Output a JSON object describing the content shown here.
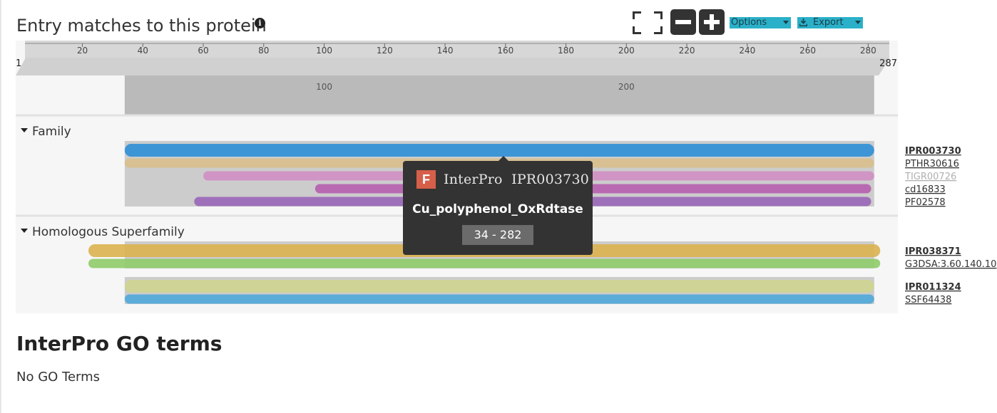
{
  "title": "Entry matches to this protein",
  "toolbar": {
    "options_label": "Options",
    "export_label": "Export"
  },
  "protein": {
    "length": 287,
    "start_label": "1",
    "end_label": "287",
    "ticks": [
      20,
      40,
      60,
      80,
      100,
      120,
      140,
      160,
      180,
      200,
      220,
      240,
      260,
      280
    ],
    "zoom_window": [
      34,
      282
    ],
    "zoom_ticks": [
      100,
      200
    ]
  },
  "sections": [
    {
      "label": "Family",
      "groups": [
        {
          "labels": [
            {
              "text": "IPR003730",
              "bold": true,
              "muted": false
            },
            {
              "text": "PTHR30616",
              "bold": false,
              "muted": false
            },
            {
              "text": "TIGR00726",
              "bold": false,
              "muted": true
            },
            {
              "text": "cd16833",
              "bold": false,
              "muted": false
            },
            {
              "text": "PF02578",
              "bold": false,
              "muted": false
            }
          ],
          "backdrop": [
            34,
            282
          ],
          "tracks": [
            {
              "start": 34,
              "end": 282,
              "color": "#2f8fd6"
            },
            {
              "start": 34,
              "end": 282,
              "color": "#d9bf8c"
            },
            {
              "start": 60,
              "end": 282,
              "color": "#d08fc3"
            },
            {
              "start": 97,
              "end": 281,
              "color": "#b65eaf"
            },
            {
              "start": 57,
              "end": 281,
              "color": "#9a66b8"
            }
          ]
        }
      ]
    },
    {
      "label": "Homologous Superfamily",
      "groups": [
        {
          "labels": [
            {
              "text": "IPR038371",
              "bold": true,
              "muted": false
            },
            {
              "text": "G3DSA:3.60.140.10",
              "bold": false,
              "muted": false
            }
          ],
          "backdrop": [
            34,
            282
          ],
          "tracks": [
            {
              "start": 22,
              "end": 284,
              "color": "#dcb250"
            },
            {
              "start": 22,
              "end": 284,
              "color": "#8fcc6a"
            }
          ]
        },
        {
          "labels": [
            {
              "text": "IPR011324",
              "bold": true,
              "muted": false
            },
            {
              "text": "SSF64438",
              "bold": false,
              "muted": false
            }
          ],
          "backdrop": [
            34,
            282
          ],
          "tracks": [
            {
              "start": 34,
              "end": 282,
              "color": "#cfd48f"
            },
            {
              "start": 34,
              "end": 282,
              "color": "#4fa9da"
            }
          ]
        }
      ]
    }
  ],
  "tooltip": {
    "badge": "F",
    "source": "InterPro",
    "accession": "IPR003730",
    "name": "Cu_polyphenol_OxRdtase",
    "range": "34 - 282"
  },
  "go_section": {
    "heading": "InterPro GO terms",
    "empty_text": "No GO Terms"
  }
}
